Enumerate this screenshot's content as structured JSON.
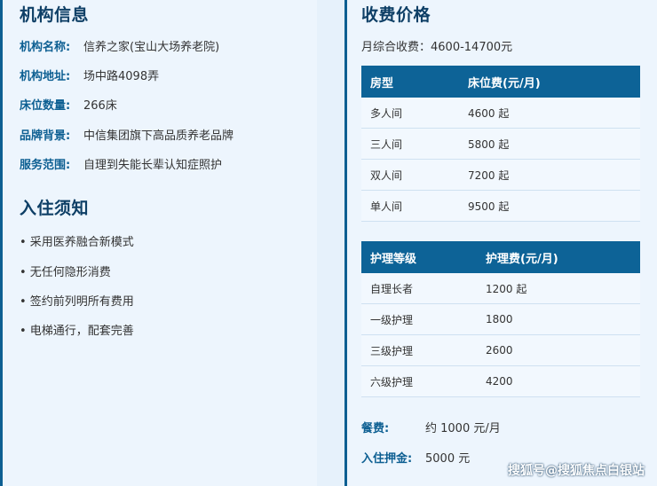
{
  "left": {
    "title": "机构信息",
    "info": [
      {
        "label": "机构名称:",
        "value": "信养之家(宝山大场养老院)"
      },
      {
        "label": "机构地址:",
        "value": "场中路4098弄"
      },
      {
        "label": "床位数量:",
        "value": "266床"
      },
      {
        "label": "品牌背景:",
        "value": "中信集团旗下高品质养老品牌"
      },
      {
        "label": "服务范围:",
        "value": "自理到失能长辈认知症照护"
      }
    ],
    "notice_title": "入住须知",
    "notices": [
      "• 采用医养融合新模式",
      "• 无任何隐形消费",
      "• 签约前列明所有费用",
      "• 电梯通行，配套完善"
    ]
  },
  "right": {
    "title": "收费价格",
    "monthly_total": "月综合收费：4600-14700元",
    "room_table": {
      "headers": [
        "房型",
        "床位费(元/月)"
      ],
      "rows": [
        [
          "多人间",
          "4600 起"
        ],
        [
          "三人间",
          "5800 起"
        ],
        [
          "双人间",
          "7200 起"
        ],
        [
          "单人间",
          "9500 起"
        ]
      ]
    },
    "care_table": {
      "headers": [
        "护理等级",
        "护理费(元/月)"
      ],
      "rows": [
        [
          "自理长者",
          "1200 起"
        ],
        [
          "一级护理",
          "1800"
        ],
        [
          "三级护理",
          "2600"
        ],
        [
          "六级护理",
          "4200"
        ]
      ]
    },
    "fees": [
      {
        "label": "餐费:",
        "value": "约 1000 元/月"
      },
      {
        "label": "入住押金:",
        "value": "5000 元"
      }
    ]
  },
  "watermark": "搜狐号@搜狐焦点白银站"
}
